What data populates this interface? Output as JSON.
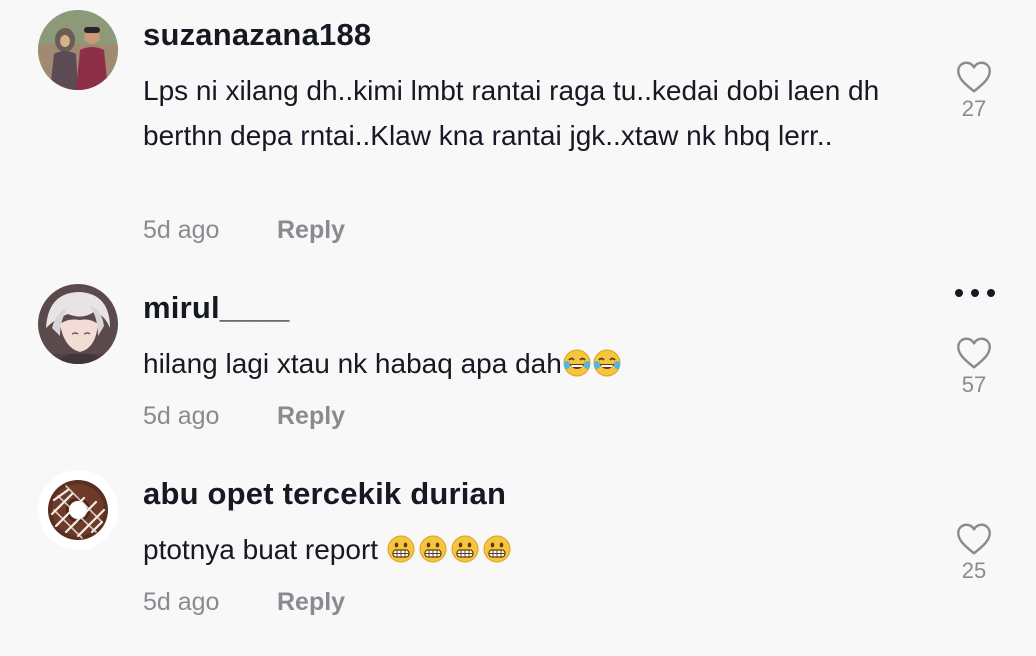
{
  "comments": [
    {
      "username": "suzanazana188",
      "text": "Lps ni xilang dh..kimi lmbt rantai raga tu..kedai dobi laen dh berthn depa rntai..Klaw kna rantai jgk..xtaw nk hbq lerr..",
      "time": "5d ago",
      "reply": "Reply",
      "likes": "27",
      "avatar_icon": "couple-photo-avatar"
    },
    {
      "username": "mirul____",
      "text": "hilang lagi xtau nk habaq apa dah",
      "emoji": [
        "😂",
        "😂"
      ],
      "time": "5d ago",
      "reply": "Reply",
      "likes": "57",
      "avatar_icon": "anime-character-avatar"
    },
    {
      "username": "abu opet tercekik durian",
      "text": "ptotnya buat report ",
      "emoji": [
        "😬",
        "😬",
        "😬",
        "😬"
      ],
      "time": "5d ago",
      "reply": "Reply",
      "likes": "25",
      "avatar_icon": "donut-avatar"
    }
  ],
  "colors": {
    "background": "#f8f8f8",
    "primary_text": "#161823",
    "secondary_text": "#8a8b91"
  },
  "icons": {
    "like": "heart-outline-icon",
    "more": "more-dots-icon"
  }
}
